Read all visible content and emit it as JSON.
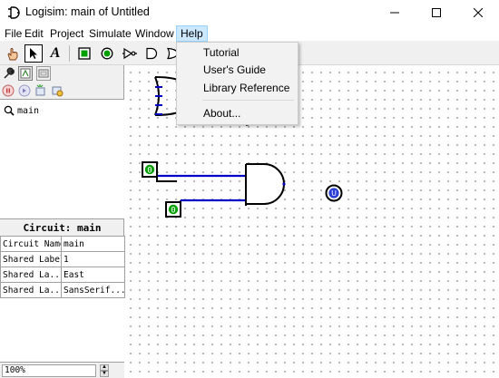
{
  "window": {
    "title": "Logisim: main of Untitled",
    "icons": [
      "logisim-logo-icon",
      "minimize-icon",
      "maximize-icon",
      "close-icon"
    ]
  },
  "menubar": {
    "items": [
      "File",
      "Edit",
      "Project",
      "Simulate",
      "Window",
      "Help"
    ],
    "active": "Help"
  },
  "help_menu": {
    "items": [
      "Tutorial",
      "User's Guide",
      "Library Reference",
      "About..."
    ]
  },
  "toolbar": {
    "text_tool_label": "A",
    "tools": [
      "hand-poke-icon",
      "select-arrow-icon",
      "text-tool-icon",
      "input-pin-icon",
      "output-pin-icon",
      "not-gate-icon",
      "and-gate-icon",
      "or-gate-icon"
    ]
  },
  "explorer": {
    "tree_item": "main",
    "tools": [
      "wrench-icon",
      "explorer-layout-icon",
      "appearance-icon",
      "stop-icon",
      "step-icon",
      "add-circuit-icon",
      "remove-circuit-icon"
    ]
  },
  "attributes": {
    "title": "Circuit: main",
    "rows": [
      {
        "key": "Circuit Name",
        "value": "main"
      },
      {
        "key": "Shared Label",
        "value": "1"
      },
      {
        "key": "Shared La...",
        "value": "East"
      },
      {
        "key": "Shared La...",
        "value": "SansSerif..."
      }
    ]
  },
  "zoom": {
    "value": "100%"
  },
  "circuit": {
    "input_pin_a": "0",
    "input_pin_b": "0",
    "output_pin": "U",
    "colors": {
      "wire": "#0000c8",
      "pin_green": "#00a000",
      "probe_blue": "#2a3ed8",
      "dark": "#000000"
    }
  }
}
